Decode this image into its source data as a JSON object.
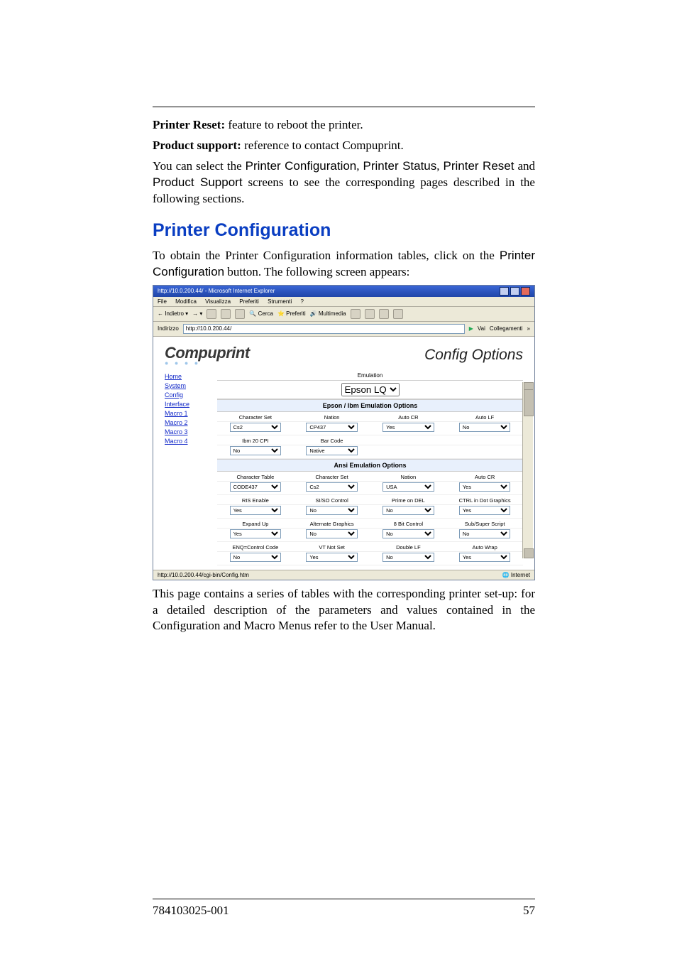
{
  "body": {
    "reset_label": "Printer Reset:",
    "reset_text": " feature to reboot the printer.",
    "support_label": "Product support:",
    "support_text": " reference to contact Compuprint.",
    "select_pre": "You can select the ",
    "select_btn1": "Printer Configuration",
    "select_sep": ", ",
    "select_btn2": "Printer Status",
    "select_btn3": "Printer Reset",
    "select_mid": " and ",
    "select_btn4": "Product Support",
    "select_post": " screens to see the corresponding pages described in the following sections."
  },
  "section_title": "Printer Configuration",
  "lead": {
    "l1": "To obtain the Printer Configuration information tables, click on the ",
    "l2": "Printer Configuration",
    "l3": " button. The following screen appears:"
  },
  "screenshot": {
    "window_title": "http://10.0.200.44/ - Microsoft Internet Explorer",
    "menus": [
      "File",
      "Modifica",
      "Visualizza",
      "Preferiti",
      "Strumenti",
      "?"
    ],
    "toolbar": [
      "Indietro",
      "Cerca",
      "Preferiti",
      "Multimedia"
    ],
    "address_label": "Indirizzo",
    "address_value": "http://10.0.200.44/",
    "go_label": "Vai",
    "links_label": "Collegamenti",
    "brand": "Compuprint",
    "page_heading": "Config Options",
    "nav": [
      "Home",
      "System",
      "Config",
      "Interface",
      "Macro 1",
      "Macro 2",
      "Macro 3",
      "Macro 4"
    ],
    "emulation_label": "Emulation",
    "emulation_value": "Epson LQ",
    "band1": "Epson / Ibm Emulation Options",
    "grid1": [
      {
        "label": "Character Set",
        "value": "Cs2"
      },
      {
        "label": "Nation",
        "value": "CP437"
      },
      {
        "label": "Auto CR",
        "value": "Yes"
      },
      {
        "label": "Auto LF",
        "value": "No"
      },
      {
        "label": "Ibm 20 CPI",
        "value": "No"
      },
      {
        "label": "Bar Code",
        "value": "Native"
      }
    ],
    "band2": "Ansi Emulation Options",
    "grid2": [
      {
        "label": "Character Table",
        "value": "CODE437"
      },
      {
        "label": "Character Set",
        "value": "Cs2"
      },
      {
        "label": "Nation",
        "value": "USA"
      },
      {
        "label": "Auto CR",
        "value": "Yes"
      },
      {
        "label": "RIS Enable",
        "value": "Yes"
      },
      {
        "label": "SI/SO Control",
        "value": "No"
      },
      {
        "label": "Prime on DEL",
        "value": "No"
      },
      {
        "label": "CTRL in Dot Graphics",
        "value": "Yes"
      },
      {
        "label": "Expand Up",
        "value": "Yes"
      },
      {
        "label": "Alternate Graphics",
        "value": "No"
      },
      {
        "label": "8 Bit Control",
        "value": "No"
      },
      {
        "label": "Sub/Super Script",
        "value": "No"
      },
      {
        "label": "ENQ=Control Code",
        "value": "No"
      },
      {
        "label": "VT Not Set",
        "value": "Yes"
      },
      {
        "label": "Double LF",
        "value": "No"
      },
      {
        "label": "Auto Wrap",
        "value": "Yes"
      }
    ],
    "status_left": "http://10.0.200.44/cgi-bin/Config.htm",
    "status_right": "Internet"
  },
  "tail": "This page contains a series of tables with the corresponding printer set-up: for a detailed description of the parameters and values contained in the Configuration and Macro Menus refer to the User Manual.",
  "footer": {
    "doc": "784103025-001",
    "page": "57"
  }
}
